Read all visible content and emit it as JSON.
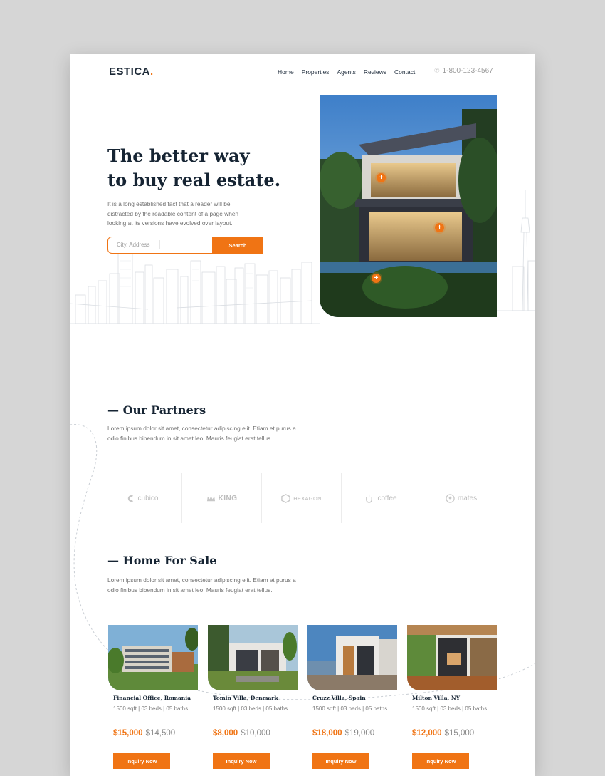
{
  "brand": {
    "name": "ESTICA",
    "dot": "."
  },
  "nav": {
    "items": [
      "Home",
      "Properties",
      "Agents",
      "Reviews",
      "Contact"
    ]
  },
  "phone": {
    "number": "1-800-123-4567"
  },
  "hero": {
    "title_line1": "The better way",
    "title_line2": "to buy real estate.",
    "text": "It is a long established fact that a reader will be distracted by the readable content of a page when looking at its versions have evolved over layout.",
    "search_placeholder": "City, Address",
    "search_button": "Search"
  },
  "partners_section": {
    "title": "— Our Partners",
    "text": "Lorem ipsum dolor sit amet, consectetur adipiscing elit. Etiam et purus a odio finibus bibendum in sit amet leo. Mauris feugiat erat tellus.",
    "logos": [
      "cubico",
      "KING",
      "HEXAGON",
      "coffee",
      "mates"
    ]
  },
  "sale_section": {
    "title": "— Home For Sale",
    "text": "Lorem ipsum dolor sit amet, consectetur adipiscing elit. Etiam et purus a odio finibus bibendum in sit amet leo. Mauris feugiat erat tellus."
  },
  "listings": [
    {
      "name": "Financial Office, Romania",
      "specs": "1500 sqft | 03 beds | 05 baths",
      "price": "$15,000",
      "old_price": "$14,500",
      "button": "Inquiry Now"
    },
    {
      "name": "Tomin Villa, Denmark",
      "specs": "1500 sqft | 03 beds | 05 baths",
      "price": "$8,000",
      "old_price": "$10,000",
      "button": "Inquiry Now"
    },
    {
      "name": "Cruzz Villa, Spain",
      "specs": "1500 sqft | 03 beds | 05 baths",
      "price": "$18,000",
      "old_price": "$19,000",
      "button": "Inquiry Now"
    },
    {
      "name": "Milton Villa, NY",
      "specs": "1500 sqft | 03 beds | 05 baths",
      "price": "$12,000",
      "old_price": "$15,000",
      "button": "Inquiry Now"
    }
  ],
  "colors": {
    "accent": "#f07414",
    "heading": "#162433",
    "page_bg": "#d6d6d6"
  }
}
